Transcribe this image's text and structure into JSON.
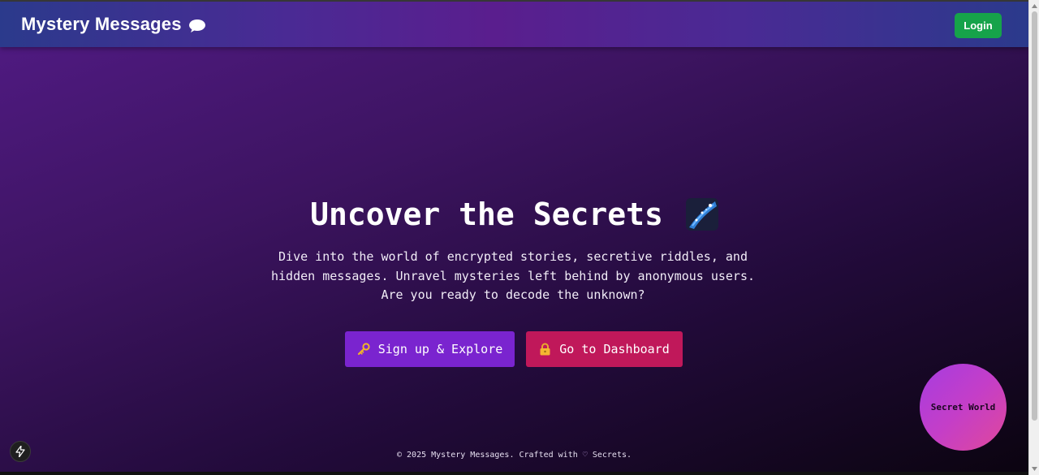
{
  "navbar": {
    "brand": "Mystery Messages",
    "brand_icon": "speech-bubble-icon",
    "login_label": "Login",
    "login_color": "#16a34a"
  },
  "hero": {
    "title": "Uncover the Secrets",
    "title_icon": "shooting-star-icon",
    "description": "Dive into the world of encrypted stories, secretive riddles, and hidden messages. Unravel mysteries left behind by anonymous users. Are you ready to decode the unknown?"
  },
  "actions": {
    "signup_label": "Sign up & Explore",
    "signup_icon": "key-icon",
    "signup_color": "#7a24cf",
    "dashboard_label": "Go to Dashboard",
    "dashboard_icon": "lock-icon",
    "dashboard_color": "#c0185a"
  },
  "floating": {
    "label": "Secret World"
  },
  "footer": {
    "prefix": "© 2025 Mystery Messages. Crafted with",
    "heart": "♡",
    "suffix": "Secrets."
  },
  "dev_badge": {
    "icon": "lightning-icon"
  }
}
